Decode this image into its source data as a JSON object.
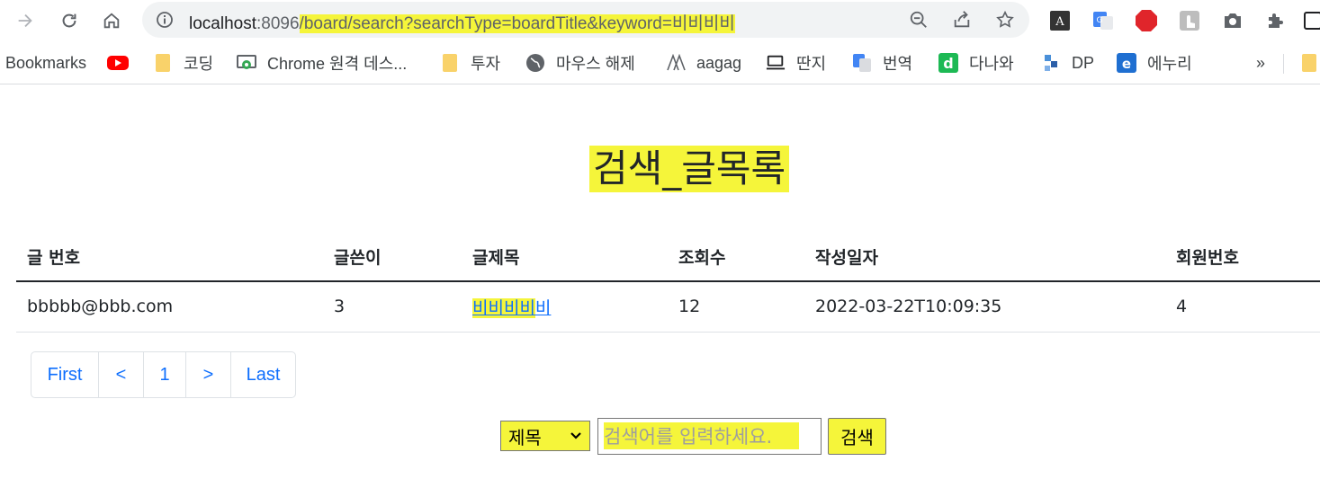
{
  "browser": {
    "url": {
      "host": "localhost",
      "port": ":8096",
      "path": "/board/search?searchType=boardTitle&keyword=비비비비"
    },
    "bookmarks": {
      "label": "Bookmarks",
      "items": [
        {
          "label": "코딩",
          "icon": "folder-icon"
        },
        {
          "label": "Chrome 원격 데스...",
          "icon": "chrome-remote-icon"
        },
        {
          "label": "투자",
          "icon": "folder-icon"
        },
        {
          "label": "마우스 해제",
          "icon": "globe-icon"
        },
        {
          "label": "aagag",
          "icon": "aagag-icon"
        },
        {
          "label": "딴지",
          "icon": "ddanzi-icon"
        },
        {
          "label": "번역",
          "icon": "translate-icon"
        },
        {
          "label": "다나와",
          "icon": "danawa-icon"
        },
        {
          "label": "DP",
          "icon": "dp-icon"
        },
        {
          "label": "에누리",
          "icon": "enuri-icon"
        }
      ],
      "overflow": "»"
    },
    "extensions": {
      "abp": "ABP"
    }
  },
  "page": {
    "title": "검색_글목록",
    "table": {
      "headers": [
        "글 번호",
        "글쓴이",
        "글제목",
        "조회수",
        "작성일자",
        "회원번호"
      ],
      "rows": [
        {
          "number": "bbbbb@bbb.com",
          "writer": "3",
          "title_highlight": "비비비비",
          "title_rest": "비",
          "views": "12",
          "date": "2022-03-22T10:09:35",
          "member_no": "4"
        }
      ]
    },
    "pagination": {
      "first": "First",
      "prev": "<",
      "page": "1",
      "next": ">",
      "last": "Last"
    },
    "search": {
      "select_value": "제목",
      "placeholder": "검색어를 입력하세요.",
      "button": "검색"
    }
  },
  "colors": {
    "highlight": "#f5f53a",
    "link": "#0d6efd"
  }
}
